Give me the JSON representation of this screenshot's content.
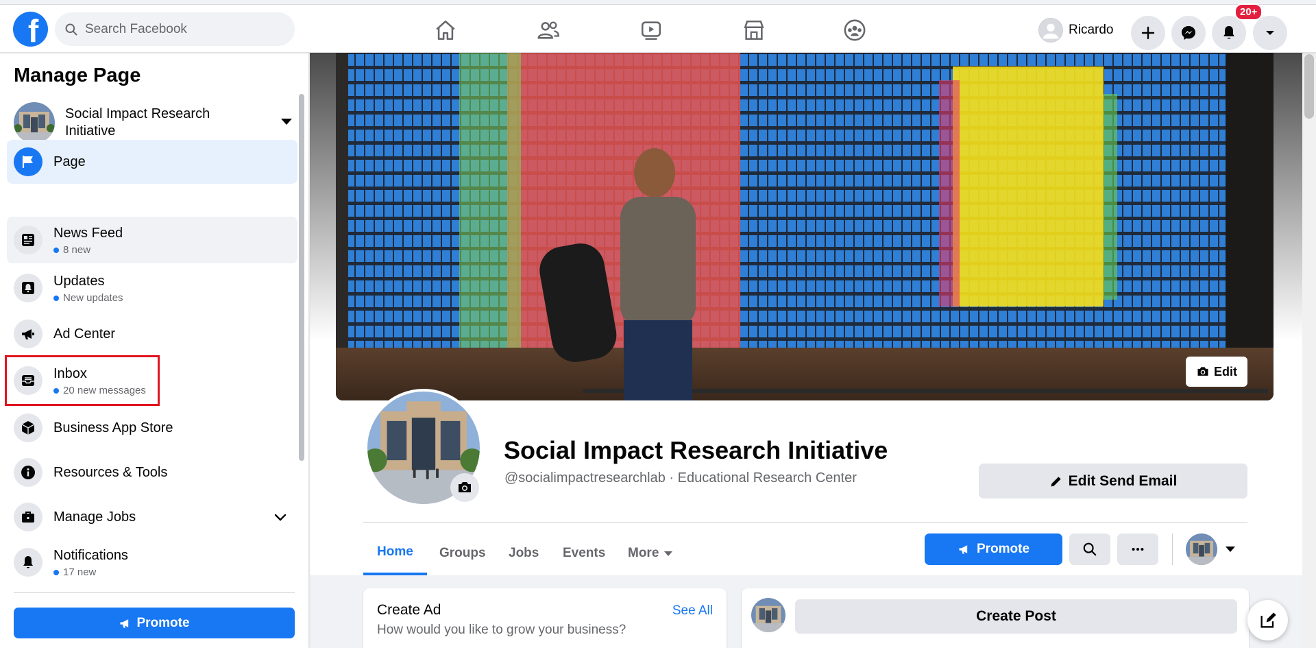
{
  "topbar": {
    "logo_letter": "f",
    "search_placeholder": "Search Facebook",
    "nav_icons": [
      "home-icon",
      "friends-icon",
      "watch-icon",
      "marketplace-icon",
      "groups-icon"
    ],
    "profile_name": "Ricardo",
    "notifications_badge": "20+",
    "buttons": [
      "create-icon",
      "messenger-icon",
      "bell-icon",
      "account-caret-icon"
    ]
  },
  "sidebar": {
    "title": "Manage Page",
    "page_name": "Social Impact Research Initiative",
    "items": [
      {
        "label": "Page",
        "sub": "",
        "icon": "flag-icon"
      },
      {
        "label": "News Feed",
        "sub": "8 new",
        "icon": "news-feed-icon"
      },
      {
        "label": "Updates",
        "sub": "New updates",
        "icon": "updates-icon"
      },
      {
        "label": "Ad Center",
        "sub": "",
        "icon": "megaphone-icon"
      },
      {
        "label": "Inbox",
        "sub": "20 new messages",
        "icon": "inbox-icon"
      },
      {
        "label": "Business App Store",
        "sub": "",
        "icon": "box-icon"
      },
      {
        "label": "Resources & Tools",
        "sub": "",
        "icon": "info-icon"
      },
      {
        "label": "Manage Jobs",
        "sub": "",
        "icon": "briefcase-icon"
      },
      {
        "label": "Notifications",
        "sub": "17 new",
        "icon": "bell-icon"
      }
    ],
    "promote_label": "Promote"
  },
  "page": {
    "name": "Social Impact Research Initiative",
    "handle": "@socialimpactresearchlab · Educational Research Center",
    "edit_cover_label": "Edit",
    "edit_send_email_label": "Edit Send Email",
    "tabs": [
      "Home",
      "Groups",
      "Jobs",
      "Events",
      "More"
    ],
    "promote_label": "Promote"
  },
  "cards": {
    "create_ad_title": "Create Ad",
    "create_ad_subtitle": "How would you like to grow your business?",
    "see_all": "See All",
    "create_post": "Create Post"
  },
  "colors": {
    "brand_blue": "#1877f2",
    "highlight_red": "#e0141e",
    "badge_red": "#e41e3f"
  }
}
